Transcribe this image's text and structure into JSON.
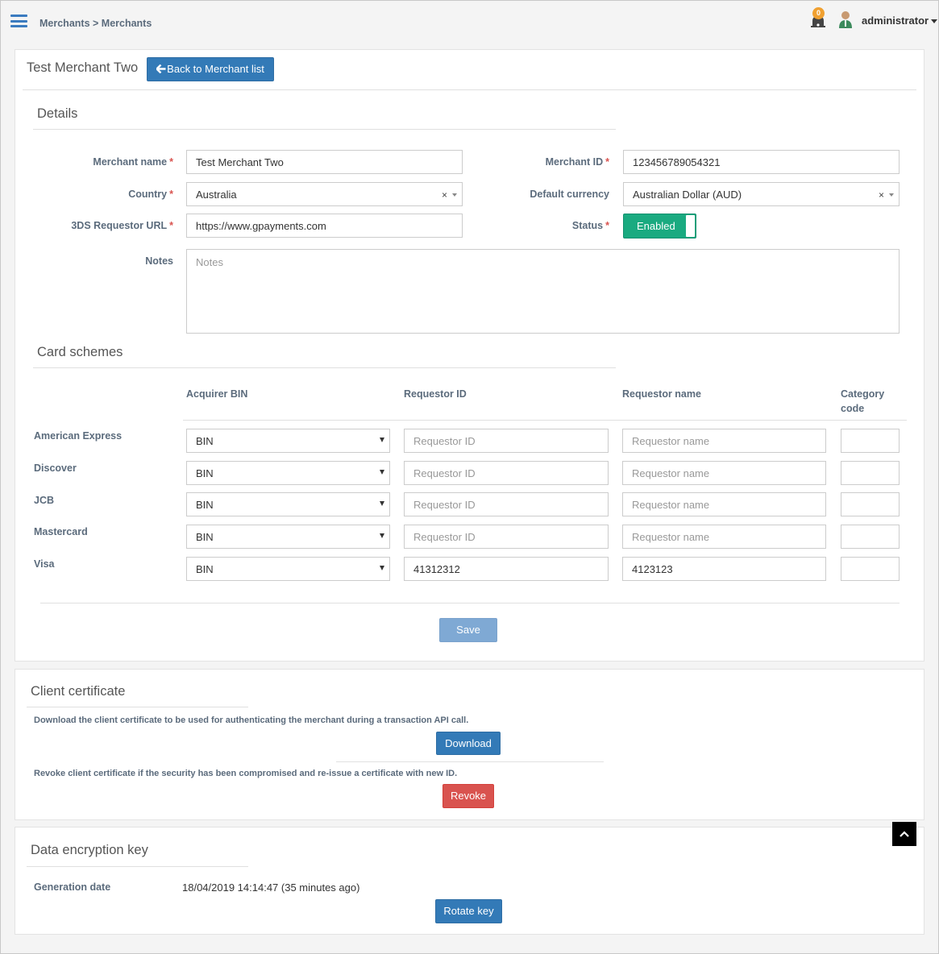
{
  "breadcrumb": {
    "parent": "Merchants",
    "separator": " > ",
    "current": "Merchants"
  },
  "header": {
    "notification_count": "0",
    "user": "administrator"
  },
  "merchant": {
    "title": "Test Merchant Two",
    "back_button": "Back to Merchant list",
    "details_title": "Details",
    "fields": {
      "merchant_name_label": "Merchant name",
      "merchant_name_value": "Test Merchant Two",
      "merchant_id_label": "Merchant ID",
      "merchant_id_value": "123456789054321",
      "country_label": "Country",
      "country_value": "Australia",
      "currency_label": "Default currency",
      "currency_value": "Australian Dollar (AUD)",
      "requestor_url_label": "3DS Requestor URL",
      "requestor_url_value": "https://www.gpayments.com",
      "status_label": "Status",
      "status_value": "Enabled",
      "notes_label": "Notes",
      "notes_placeholder": "Notes",
      "required_mark": "*",
      "clear_mark": "×"
    },
    "card_schemes_title": "Card schemes",
    "columns": {
      "acquirer_bin": "Acquirer BIN",
      "requestor_id": "Requestor ID",
      "requestor_name": "Requestor name",
      "category_code_1": "Category",
      "category_code_2": "code"
    },
    "schemes": [
      {
        "name": "American Express",
        "bin": "BIN",
        "requestor_id": "",
        "requestor_name": "",
        "category_code": ""
      },
      {
        "name": "Discover",
        "bin": "BIN",
        "requestor_id": "",
        "requestor_name": "",
        "category_code": ""
      },
      {
        "name": "JCB",
        "bin": "BIN",
        "requestor_id": "",
        "requestor_name": "",
        "category_code": ""
      },
      {
        "name": "Mastercard",
        "bin": "BIN",
        "requestor_id": "",
        "requestor_name": "",
        "category_code": ""
      },
      {
        "name": "Visa",
        "bin": "BIN",
        "requestor_id": "41312312",
        "requestor_name": "4123123",
        "category_code": ""
      }
    ],
    "placeholders": {
      "requestor_id": "Requestor ID",
      "requestor_name": "Requestor name"
    },
    "save_button": "Save"
  },
  "client_certificate": {
    "title": "Client certificate",
    "download_note": "Download the client certificate to be used for authenticating the merchant during a transaction API call.",
    "download_button": "Download",
    "revoke_note": "Revoke client certificate if the security has been compromised and re-issue a certificate with new ID.",
    "revoke_button": "Revoke"
  },
  "encryption_key": {
    "title": "Data encryption key",
    "generation_label": "Generation date",
    "generation_value": "18/04/2019 14:14:47 (35 minutes ago)",
    "rotate_button": "Rotate key"
  },
  "colors": {
    "primary": "#337ab7",
    "danger": "#d9534f",
    "success": "#1aaa80",
    "save_disabled": "#7fa9d4",
    "badge": "#f0a030"
  },
  "icons": {
    "menu": "hamburger-icon",
    "back": "arrow-left-icon",
    "notification": "bell-icon",
    "user": "user-icon",
    "scroll_top": "chevron-up-icon"
  }
}
